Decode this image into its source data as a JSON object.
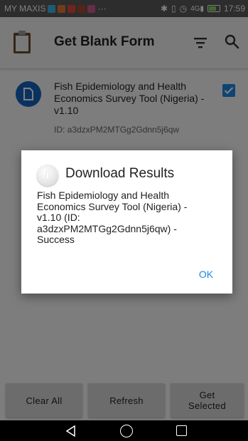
{
  "status_bar": {
    "carrier": "MY MAXIS",
    "overflow": "···",
    "network": "4G",
    "time": "17:59",
    "battery_level": 0.7
  },
  "app_bar": {
    "title": "Get Blank Form",
    "icons": [
      "clipboard-icon",
      "sort-icon",
      "search-icon"
    ]
  },
  "form_list": [
    {
      "title": "Fish Epidemiology and Health Economics Survey Tool (Nigeria) - v1.10",
      "id_text": "ID: a3dzxPM2MTGg2Gdnn5j6qw",
      "checked": true
    }
  ],
  "buttons": {
    "clear_all": "Clear All",
    "refresh": "Refresh",
    "get_selected": "Get\nSelected"
  },
  "dialog": {
    "title": "Download Results",
    "message": "Fish Epidemiology and Health Economics Survey Tool (Nigeria) - v1.10 (ID: a3dzxPM2MTGg2Gdnn5j6qw) - Success",
    "ok_label": "OK"
  },
  "colors": {
    "accent": "#1e88e5",
    "form_icon": "#1565c0",
    "status_bar": "#5a5a5a"
  }
}
